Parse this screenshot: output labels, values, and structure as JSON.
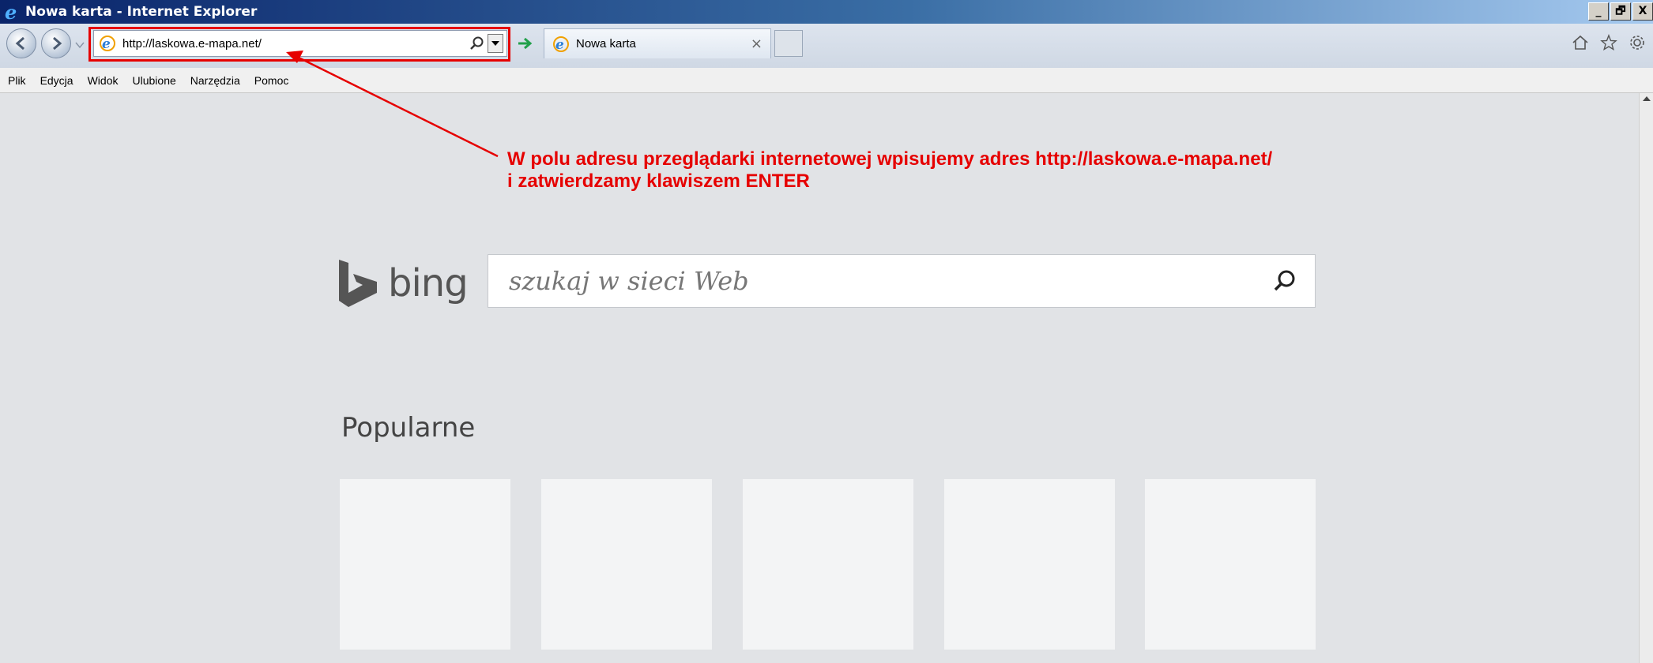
{
  "window": {
    "title": "Nowa karta - Internet Explorer",
    "controls": [
      "_",
      "🗗",
      "X"
    ]
  },
  "navigation": {
    "url": "http://laskowa.e-mapa.net/",
    "tab_label": "Nowa karta",
    "tab_close": "×"
  },
  "menu": {
    "items": [
      "Plik",
      "Edycja",
      "Widok",
      "Ulubione",
      "Narzędzia",
      "Pomoc"
    ]
  },
  "annotation": {
    "line1": "W polu adresu przeglądarki internetowej wpisujemy adres http://laskowa.e-mapa.net/",
    "line2": "i zatwierdzamy klawiszem ENTER",
    "color": "#e60000"
  },
  "bing": {
    "logo_text": "bing",
    "search_placeholder": "szukaj w sieci Web"
  },
  "popular": {
    "title": "Popularne",
    "tiles": [
      "",
      "",
      "",
      "",
      ""
    ]
  }
}
